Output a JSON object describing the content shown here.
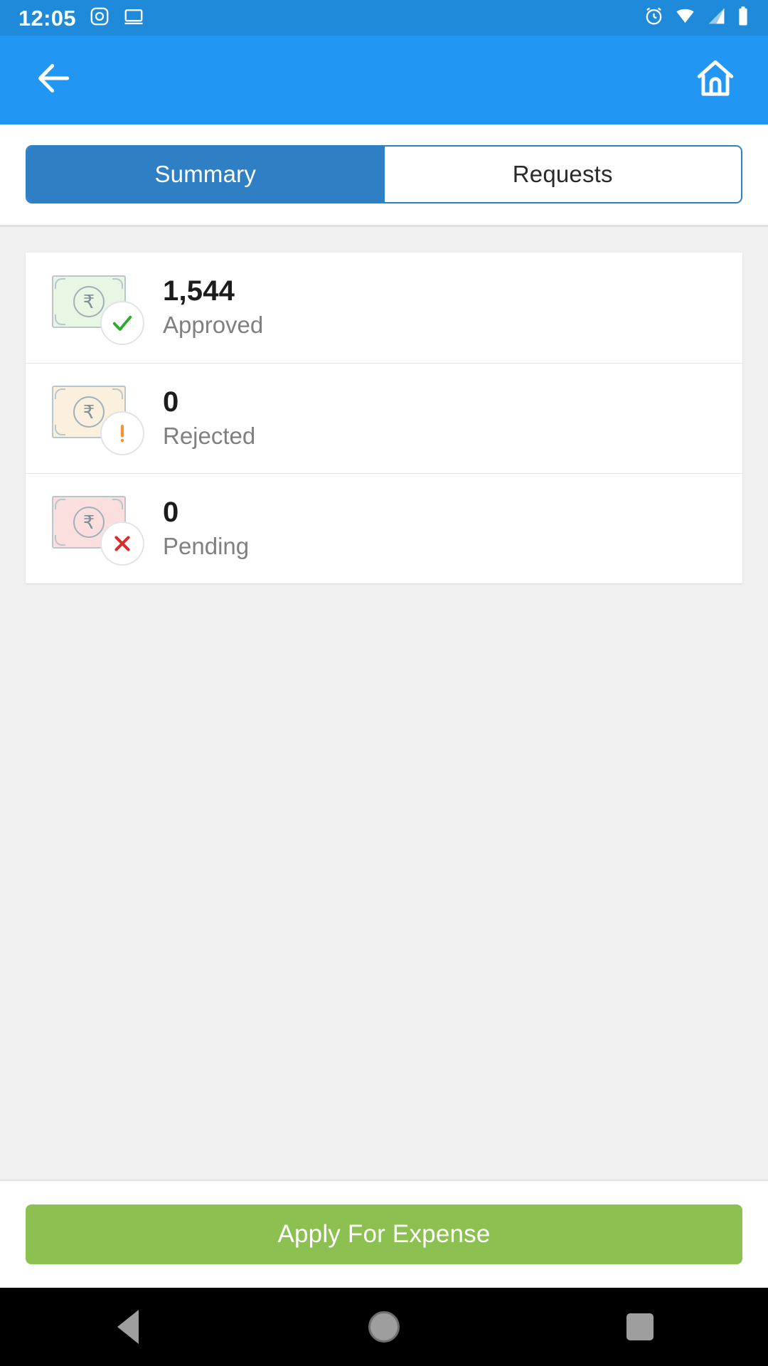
{
  "status_bar": {
    "time": "12:05",
    "left_icons": [
      "camera-icon",
      "cast-screen-icon"
    ],
    "right_icons": [
      "alarm-icon",
      "wifi-icon",
      "cellular-signal-icon",
      "battery-icon"
    ],
    "background_color": "#1f8ad9"
  },
  "app_bar": {
    "background_color": "#2196f3",
    "back_icon": "back-arrow-icon",
    "home_icon": "home-icon"
  },
  "tabs": {
    "active_index": 0,
    "active_color": "#2e7fc4",
    "items": [
      {
        "label": "Summary"
      },
      {
        "label": "Requests"
      }
    ]
  },
  "summary": {
    "rows": [
      {
        "value": "1,544",
        "label": "Approved",
        "note_color": "#e8f6e4",
        "badge_icon": "check-icon",
        "badge_color": "#2eaa2e",
        "currency_symbol": "₹"
      },
      {
        "value": "0",
        "label": "Rejected",
        "note_color": "#fbf0dd",
        "badge_icon": "exclamation-icon",
        "badge_color": "#f0933a",
        "currency_symbol": "₹"
      },
      {
        "value": "0",
        "label": "Pending",
        "note_color": "#fbdfdf",
        "badge_icon": "close-x-icon",
        "badge_color": "#d32f2f",
        "currency_symbol": "₹"
      }
    ]
  },
  "bottom_action": {
    "label": "Apply For Expense",
    "color": "#8cc152"
  },
  "nav_bar": {
    "back_icon": "nav-back-icon",
    "home_icon": "nav-home-icon",
    "recents_icon": "nav-recents-icon"
  }
}
